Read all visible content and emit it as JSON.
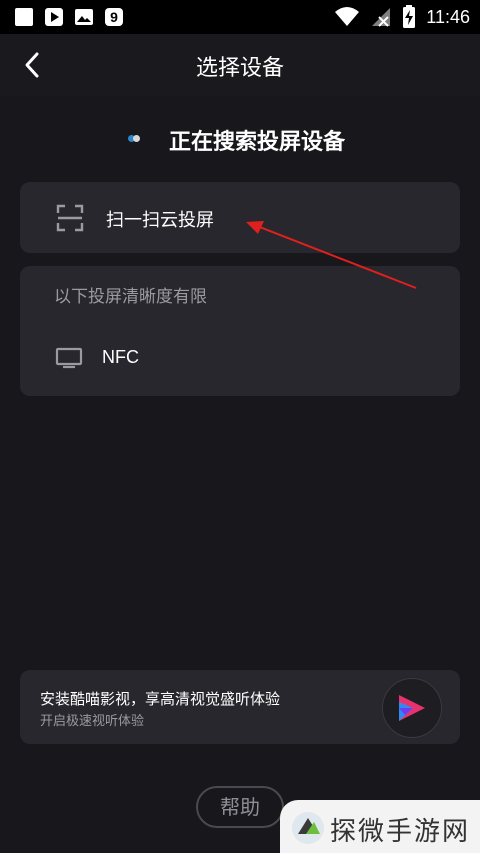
{
  "status_bar": {
    "time": "11:46",
    "left_icons": [
      "square-notification-icon",
      "play-store-icon",
      "image-icon",
      "nine-app-icon"
    ],
    "right_icons": [
      "wifi-icon",
      "no-signal-icon",
      "battery-charging-icon"
    ]
  },
  "header": {
    "title": "选择设备",
    "back_icon": "chevron-left-icon"
  },
  "searching": {
    "text": "正在搜索投屏设备",
    "dot_colors": [
      "#2f86c8",
      "#d7d9dd"
    ]
  },
  "scan_card": {
    "label": "扫一扫云投屏",
    "icon": "scan-icon"
  },
  "devices_card": {
    "notice": "以下投屏清晰度有限",
    "devices": [
      {
        "name": "NFC",
        "icon": "tv-icon"
      }
    ]
  },
  "promo": {
    "title": "安装酷喵影视，享高清视觉盛听体验",
    "subtitle": "开启极速视听体验",
    "app_icon": "kumiao-app-icon"
  },
  "help_button": {
    "label": "帮助"
  },
  "watermark": {
    "text": "探微手游网"
  },
  "colors": {
    "background": "#18171c",
    "card": "#28272d",
    "annotation_arrow": "#e0201f",
    "secondary_text": "#9b9aa2"
  }
}
